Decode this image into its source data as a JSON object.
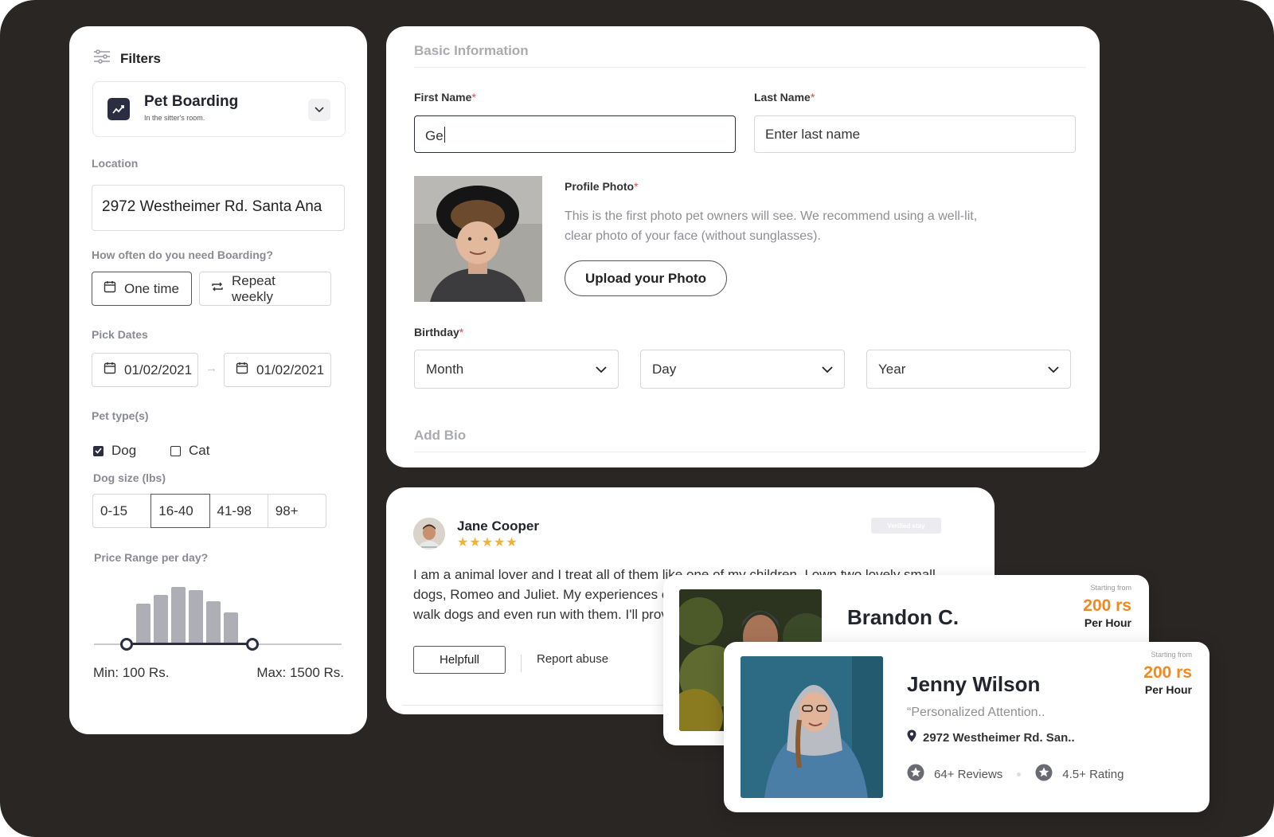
{
  "filters": {
    "title": "Filters",
    "service": {
      "title": "Pet Boarding",
      "subtitle": "In the sitter's room."
    },
    "location": {
      "label": "Location",
      "value": "2972 Westheimer Rd. Santa Ana"
    },
    "frequency": {
      "label": "How often do you need Boarding?",
      "options": [
        "One time",
        "Repeat weekly"
      ],
      "selected": "One time"
    },
    "dates": {
      "label": "Pick Dates",
      "start": "01/02/2021",
      "end": "01/02/2021"
    },
    "pet_types": {
      "label": "Pet type(s)",
      "options": [
        {
          "label": "Dog",
          "checked": true
        },
        {
          "label": "Cat",
          "checked": false
        }
      ]
    },
    "dog_size": {
      "label": "Dog size (lbs)",
      "options": [
        "0-15",
        "16-40",
        "41-98",
        "98+"
      ],
      "selected": "16-40"
    },
    "price": {
      "label": "Price Range per day?",
      "min_text": "Min: 100 Rs.",
      "max_text": "Max: 1500 Rs.",
      "histogram_relative": [
        0.7,
        0.86,
        1.0,
        0.94,
        0.74,
        0.55
      ]
    }
  },
  "basic_info": {
    "title": "Basic Information",
    "first_name": {
      "label": "First Name",
      "required": "*",
      "value": "Ge"
    },
    "last_name": {
      "label": "Last Name",
      "required": "*",
      "placeholder": "Enter last name"
    },
    "profile_photo": {
      "label": "Profile Photo",
      "required": "*",
      "description": "This is the first photo pet owners will see. We recommend using a well-lit, clear photo of your face (without sunglasses).",
      "button": "Upload your Photo"
    },
    "birthday": {
      "label": "Birthday",
      "required": "*",
      "month": "Month",
      "day": "Day",
      "year": "Year"
    },
    "bio_title": "Add Bio"
  },
  "review": {
    "name": "Jane Cooper",
    "stars": "★★★★★",
    "badge": "Verified stay",
    "text": "I am a animal lover and I treat all of them like one of my children. I own two lovely small dogs, Romeo and Juliet. My experiences over the years have been with dogs. I love to walk dogs and even run with them. I'll provide",
    "helpful": "Helpfull",
    "report": "Report abuse"
  },
  "sitters": [
    {
      "name": "Brandon C.",
      "price_from": "Starting from",
      "price": "200 rs",
      "unit": "Per Hour"
    },
    {
      "name": "Jenny Wilson",
      "quote": "“Personalized Attention..",
      "address": "2972 Westheimer Rd. San..",
      "reviews": "64+ Reviews",
      "rating": "4.5+ Rating",
      "price_from": "Starting from",
      "price": "200 rs",
      "unit": "Per Hour"
    }
  ],
  "colors": {
    "background": "#2a2623",
    "accent": "#f08a20",
    "primary": "#2b2d42",
    "required": "#e04444",
    "stars": "#f2b233"
  }
}
